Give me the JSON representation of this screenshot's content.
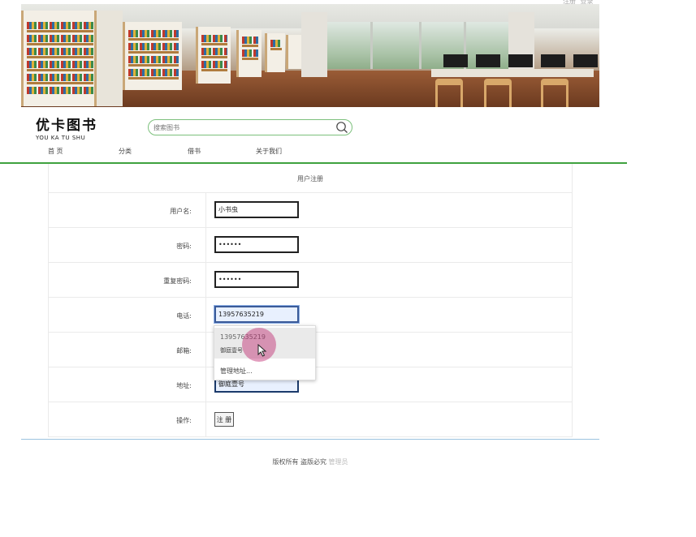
{
  "top_links": [
    "注册",
    "登录"
  ],
  "logo": {
    "cn": "优卡图书",
    "en": "YOU KA TU SHU"
  },
  "search": {
    "placeholder": "搜索图书",
    "icon": "search-icon"
  },
  "nav": [
    "首 页",
    "分类",
    "借书",
    "关于我们"
  ],
  "form": {
    "title": "用户注册",
    "rows": [
      {
        "label": "用户名:",
        "value": "小书虫"
      },
      {
        "label": "密码:",
        "value": "••••••"
      },
      {
        "label": "重复密码:",
        "value": "••••••"
      },
      {
        "label": "电话:",
        "value": "13957635219"
      },
      {
        "label": "邮箱:",
        "value": ""
      },
      {
        "label": "地址:",
        "value": "御庭壹号"
      },
      {
        "label": "操作:",
        "button": "注 册"
      }
    ]
  },
  "autofill": {
    "suggestion_phone": "13957635219",
    "suggestion_addr": "御庭壹号",
    "manage": "管理地址..."
  },
  "footer": {
    "text": "版权所有 盗版必究",
    "admin": "管理员"
  },
  "colors": {
    "nav_line": "#3fa23f",
    "search_border": "#7cc07c",
    "footer_line": "#9cc3e0"
  }
}
